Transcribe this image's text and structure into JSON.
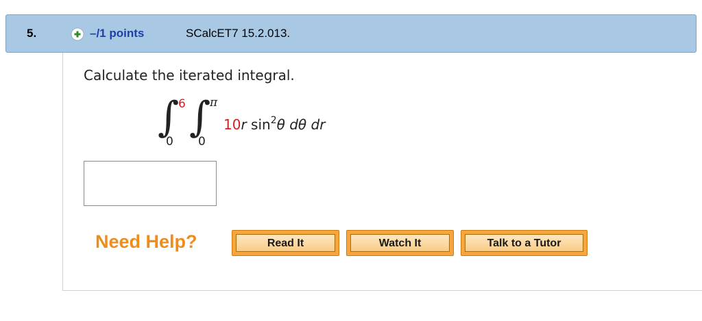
{
  "question": {
    "number": "5.",
    "points": "–/1 points",
    "source": "SCalcET7 15.2.013."
  },
  "body": {
    "prompt": "Calculate the iterated integral.",
    "integral": {
      "outer_upper": "6",
      "outer_lower": "0",
      "inner_upper": "π",
      "inner_lower": "0",
      "coefficient": "10",
      "r_var": "r",
      "sin_text": " sin",
      "exponent": "2",
      "theta": "θ",
      "d_theta": " dθ",
      "d_r": " dr"
    },
    "answer": {
      "value": ""
    }
  },
  "help": {
    "label": "Need Help?",
    "read_it": "Read It",
    "watch_it": "Watch It",
    "talk_to_tutor": "Talk to a Tutor"
  },
  "colors": {
    "header_bg": "#a8c8e4",
    "points_blue": "#1f3fa8",
    "limit_red": "#d42020",
    "help_orange": "#f08c1c",
    "button_orange": "#f6a63a",
    "plus_green": "#2e8b2e"
  },
  "icons": {
    "expand": "plus-circle-icon"
  }
}
